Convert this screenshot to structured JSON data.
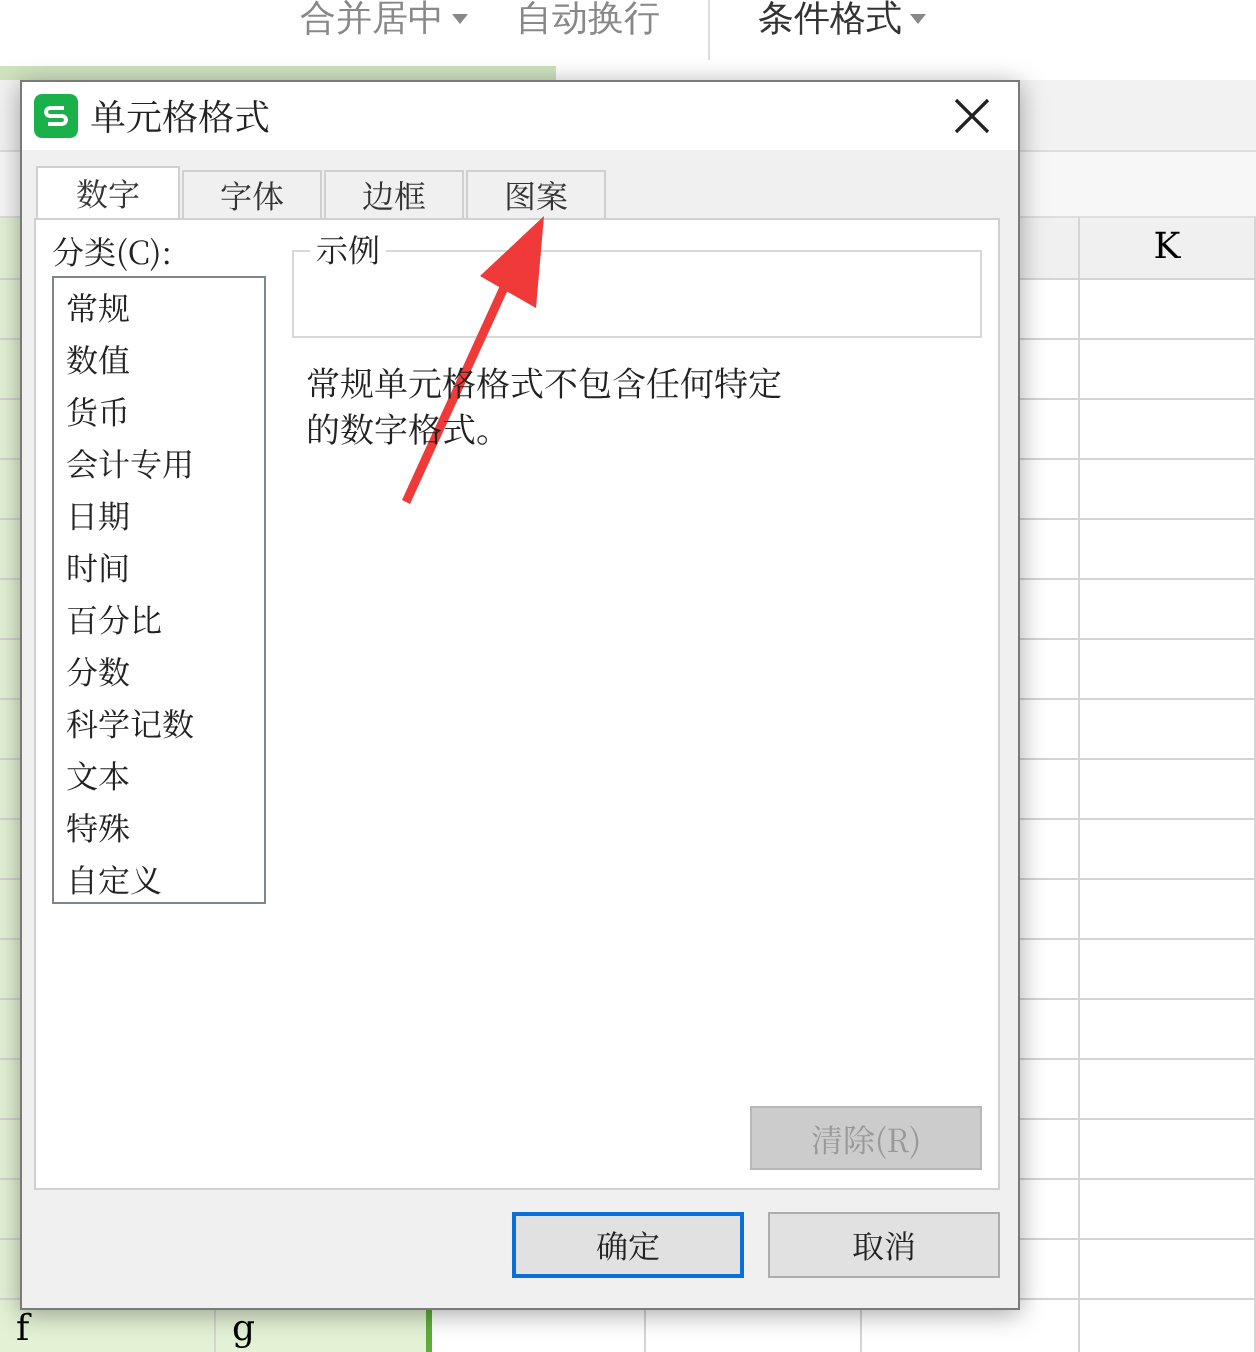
{
  "ribbon": {
    "items": [
      {
        "label": "合并居中",
        "caret": true
      },
      {
        "label": "自动换行",
        "caret": false
      },
      {
        "label": "条件格式",
        "caret": true
      }
    ]
  },
  "sheet": {
    "column_header": "K",
    "bottom_row": [
      "f",
      "g"
    ]
  },
  "dialog": {
    "title": "单元格格式",
    "tabs": [
      {
        "label": "数字",
        "selected": true
      },
      {
        "label": "字体",
        "selected": false
      },
      {
        "label": "边框",
        "selected": false
      },
      {
        "label": "图案",
        "selected": false
      }
    ],
    "category_label": "分类(C):",
    "categories": [
      "常规",
      "数值",
      "货币",
      "会计专用",
      "日期",
      "时间",
      "百分比",
      "分数",
      "科学记数",
      "文本",
      "特殊",
      "自定义"
    ],
    "sample_label": "示例",
    "description": "常规单元格格式不包含任何特定的数字格式。",
    "clear_button": {
      "label": "清除(R)",
      "disabled": true
    },
    "buttons": [
      {
        "label": "确定",
        "default": true
      },
      {
        "label": "取消",
        "default": false
      }
    ]
  }
}
